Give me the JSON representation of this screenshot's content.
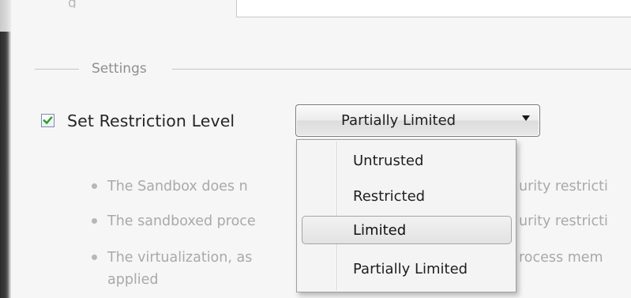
{
  "top_row": {
    "label_fragment": "g"
  },
  "settings_group": {
    "title": "Settings"
  },
  "restriction": {
    "checkbox_checked": true,
    "label": "Set Restriction Level",
    "selected_value": "Partially Limited"
  },
  "dropdown": {
    "options": [
      {
        "label": "Untrusted",
        "highlighted": false
      },
      {
        "label": "Restricted",
        "highlighted": false
      },
      {
        "label": "Limited",
        "highlighted": true
      },
      {
        "label": "Partially Limited",
        "highlighted": false
      }
    ]
  },
  "bullets": [
    {
      "left": "The Sandbox does n",
      "right": "urity restricti"
    },
    {
      "left": "The sandboxed proce",
      "right": "urity restricti"
    },
    {
      "left": "The virtualization, as",
      "right": "rocess mem",
      "continuation": "applied"
    }
  ],
  "colors": {
    "checkbox_check": "#2b9a2b",
    "background": "#f6f6f6",
    "muted_text": "#a9a9a9"
  }
}
